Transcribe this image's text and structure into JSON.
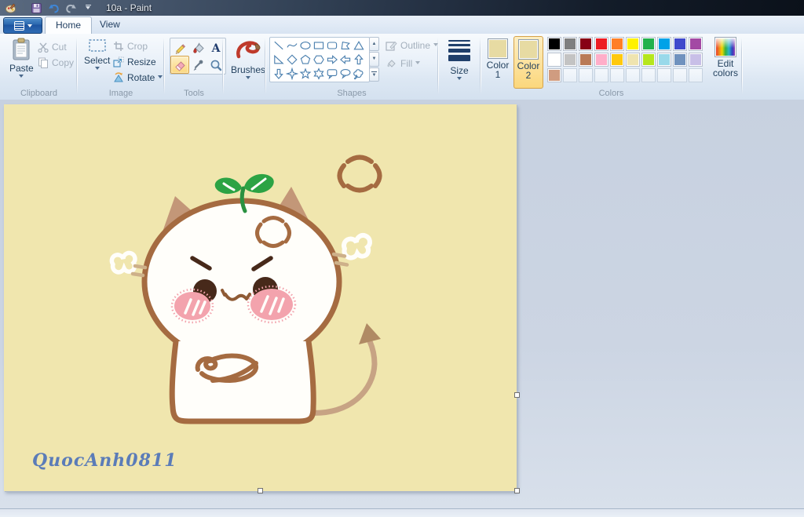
{
  "titlebar": {
    "title": "10a - Paint",
    "icons": [
      "paint-app-icon",
      "save-icon",
      "undo-icon",
      "redo-icon",
      "customize-quick-access-icon"
    ]
  },
  "tabs": {
    "home": "Home",
    "view": "View"
  },
  "ribbon": {
    "clipboard": {
      "label": "Clipboard",
      "paste": "Paste",
      "cut": "Cut",
      "copy": "Copy"
    },
    "image": {
      "label": "Image",
      "select": "Select",
      "crop": "Crop",
      "resize": "Resize",
      "rotate": "Rotate"
    },
    "tools": {
      "label": "Tools",
      "items": [
        "pencil",
        "fill-bucket",
        "text",
        "eraser",
        "color-picker",
        "magnifier"
      ],
      "selected": "eraser"
    },
    "brushes": {
      "label": "Brushes"
    },
    "shapes": {
      "label": "Shapes",
      "outline": "Outline",
      "fill": "Fill",
      "items": [
        "line",
        "curve",
        "ellipse",
        "rectangle",
        "rounded-rectangle",
        "polygon",
        "triangle",
        "right-triangle",
        "diamond",
        "pentagon",
        "hexagon",
        "arrow-right",
        "arrow-left",
        "arrow-up",
        "arrow-down",
        "star-4",
        "star-5",
        "star-6",
        "callout-rounded",
        "callout-oval",
        "callout-cloud"
      ]
    },
    "size": {
      "label": "Size"
    },
    "colors": {
      "label": "Colors",
      "color1_label": "Color 1",
      "color2_label": "Color 2",
      "edit_label": "Edit colors",
      "color1": "#e7dba3",
      "color2": "#e7dba3",
      "active_slot": "color2",
      "palette_rows": [
        [
          "#000000",
          "#7f7f7f",
          "#880015",
          "#ed1c24",
          "#ff7f27",
          "#fff200",
          "#22b14c",
          "#00a2e8",
          "#3f48cc",
          "#a349a4"
        ],
        [
          "#ffffff",
          "#c3c3c3",
          "#b97a57",
          "#ffaec9",
          "#ffc90e",
          "#efe4b0",
          "#b5e61d",
          "#99d9ea",
          "#7092be",
          "#c8bfe7"
        ],
        [
          "#d09c80",
          null,
          null,
          null,
          null,
          null,
          null,
          null,
          null,
          null
        ]
      ]
    }
  },
  "canvas": {
    "background": "#f0e6ae",
    "signature": "QuocAnh0811",
    "drawing": {
      "subject": "angry chibi cat with sprout on head, steam puffs, anger marks, devil tail",
      "outline": "#a56b41",
      "body": "#fffefa",
      "ear": "#c39778",
      "sprout": "#2ca344",
      "blush": "#f3a3ad",
      "eye": "#47291a",
      "mouth": "#8f5b35",
      "tail": "#c7a384",
      "tailtip": "#b08a64",
      "steam": "#fffefa",
      "dash": "#cdb089",
      "signature_color": "#5b7cb8"
    }
  }
}
